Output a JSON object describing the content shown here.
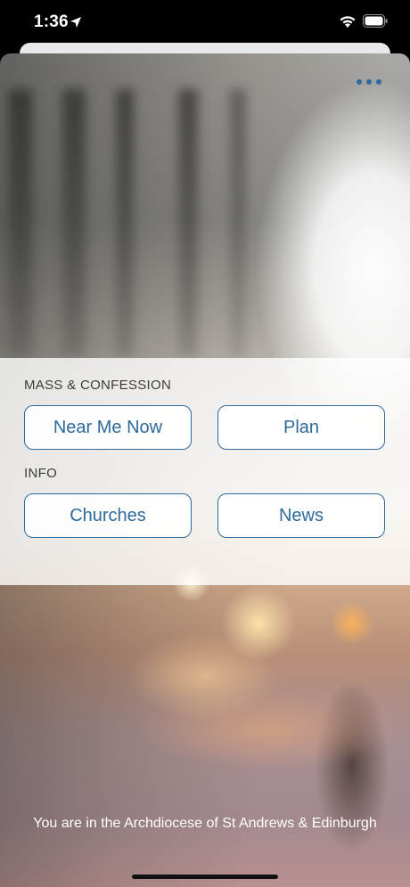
{
  "status_bar": {
    "time": "1:36"
  },
  "menu": {
    "icon": "more-horizontal-icon"
  },
  "sections": {
    "mass": {
      "label": "MASS & CONFESSION",
      "buttons": [
        "Near Me Now",
        "Plan"
      ]
    },
    "info": {
      "label": "INFO",
      "buttons": [
        "Churches",
        "News"
      ]
    }
  },
  "footer": {
    "text": "You are in the Archdiocese of St Andrews & Edinburgh"
  },
  "colors": {
    "accent": "#2e6a9b",
    "panel": "#ffffff"
  }
}
